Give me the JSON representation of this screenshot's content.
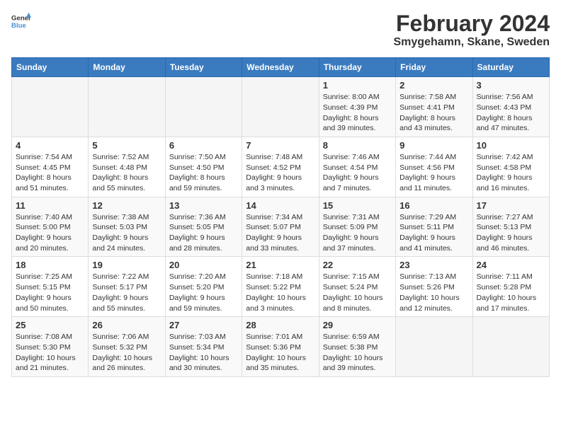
{
  "header": {
    "logo_line1": "General",
    "logo_line2": "Blue",
    "month": "February 2024",
    "location": "Smygehamn, Skane, Sweden"
  },
  "weekdays": [
    "Sunday",
    "Monday",
    "Tuesday",
    "Wednesday",
    "Thursday",
    "Friday",
    "Saturday"
  ],
  "weeks": [
    [
      {
        "day": "",
        "info": ""
      },
      {
        "day": "",
        "info": ""
      },
      {
        "day": "",
        "info": ""
      },
      {
        "day": "",
        "info": ""
      },
      {
        "day": "1",
        "info": "Sunrise: 8:00 AM\nSunset: 4:39 PM\nDaylight: 8 hours\nand 39 minutes."
      },
      {
        "day": "2",
        "info": "Sunrise: 7:58 AM\nSunset: 4:41 PM\nDaylight: 8 hours\nand 43 minutes."
      },
      {
        "day": "3",
        "info": "Sunrise: 7:56 AM\nSunset: 4:43 PM\nDaylight: 8 hours\nand 47 minutes."
      }
    ],
    [
      {
        "day": "4",
        "info": "Sunrise: 7:54 AM\nSunset: 4:45 PM\nDaylight: 8 hours\nand 51 minutes."
      },
      {
        "day": "5",
        "info": "Sunrise: 7:52 AM\nSunset: 4:48 PM\nDaylight: 8 hours\nand 55 minutes."
      },
      {
        "day": "6",
        "info": "Sunrise: 7:50 AM\nSunset: 4:50 PM\nDaylight: 8 hours\nand 59 minutes."
      },
      {
        "day": "7",
        "info": "Sunrise: 7:48 AM\nSunset: 4:52 PM\nDaylight: 9 hours\nand 3 minutes."
      },
      {
        "day": "8",
        "info": "Sunrise: 7:46 AM\nSunset: 4:54 PM\nDaylight: 9 hours\nand 7 minutes."
      },
      {
        "day": "9",
        "info": "Sunrise: 7:44 AM\nSunset: 4:56 PM\nDaylight: 9 hours\nand 11 minutes."
      },
      {
        "day": "10",
        "info": "Sunrise: 7:42 AM\nSunset: 4:58 PM\nDaylight: 9 hours\nand 16 minutes."
      }
    ],
    [
      {
        "day": "11",
        "info": "Sunrise: 7:40 AM\nSunset: 5:00 PM\nDaylight: 9 hours\nand 20 minutes."
      },
      {
        "day": "12",
        "info": "Sunrise: 7:38 AM\nSunset: 5:03 PM\nDaylight: 9 hours\nand 24 minutes."
      },
      {
        "day": "13",
        "info": "Sunrise: 7:36 AM\nSunset: 5:05 PM\nDaylight: 9 hours\nand 28 minutes."
      },
      {
        "day": "14",
        "info": "Sunrise: 7:34 AM\nSunset: 5:07 PM\nDaylight: 9 hours\nand 33 minutes."
      },
      {
        "day": "15",
        "info": "Sunrise: 7:31 AM\nSunset: 5:09 PM\nDaylight: 9 hours\nand 37 minutes."
      },
      {
        "day": "16",
        "info": "Sunrise: 7:29 AM\nSunset: 5:11 PM\nDaylight: 9 hours\nand 41 minutes."
      },
      {
        "day": "17",
        "info": "Sunrise: 7:27 AM\nSunset: 5:13 PM\nDaylight: 9 hours\nand 46 minutes."
      }
    ],
    [
      {
        "day": "18",
        "info": "Sunrise: 7:25 AM\nSunset: 5:15 PM\nDaylight: 9 hours\nand 50 minutes."
      },
      {
        "day": "19",
        "info": "Sunrise: 7:22 AM\nSunset: 5:17 PM\nDaylight: 9 hours\nand 55 minutes."
      },
      {
        "day": "20",
        "info": "Sunrise: 7:20 AM\nSunset: 5:20 PM\nDaylight: 9 hours\nand 59 minutes."
      },
      {
        "day": "21",
        "info": "Sunrise: 7:18 AM\nSunset: 5:22 PM\nDaylight: 10 hours\nand 3 minutes."
      },
      {
        "day": "22",
        "info": "Sunrise: 7:15 AM\nSunset: 5:24 PM\nDaylight: 10 hours\nand 8 minutes."
      },
      {
        "day": "23",
        "info": "Sunrise: 7:13 AM\nSunset: 5:26 PM\nDaylight: 10 hours\nand 12 minutes."
      },
      {
        "day": "24",
        "info": "Sunrise: 7:11 AM\nSunset: 5:28 PM\nDaylight: 10 hours\nand 17 minutes."
      }
    ],
    [
      {
        "day": "25",
        "info": "Sunrise: 7:08 AM\nSunset: 5:30 PM\nDaylight: 10 hours\nand 21 minutes."
      },
      {
        "day": "26",
        "info": "Sunrise: 7:06 AM\nSunset: 5:32 PM\nDaylight: 10 hours\nand 26 minutes."
      },
      {
        "day": "27",
        "info": "Sunrise: 7:03 AM\nSunset: 5:34 PM\nDaylight: 10 hours\nand 30 minutes."
      },
      {
        "day": "28",
        "info": "Sunrise: 7:01 AM\nSunset: 5:36 PM\nDaylight: 10 hours\nand 35 minutes."
      },
      {
        "day": "29",
        "info": "Sunrise: 6:59 AM\nSunset: 5:38 PM\nDaylight: 10 hours\nand 39 minutes."
      },
      {
        "day": "",
        "info": ""
      },
      {
        "day": "",
        "info": ""
      }
    ]
  ]
}
